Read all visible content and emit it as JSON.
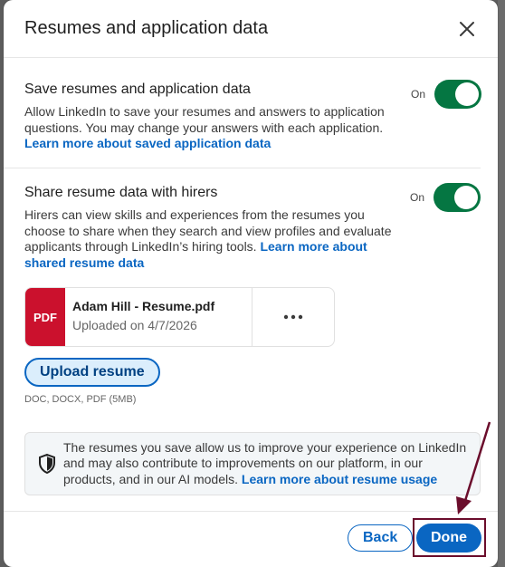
{
  "modal": {
    "title": "Resumes and application data",
    "close_icon": "close-icon"
  },
  "save_section": {
    "title": "Save resumes and application data",
    "description": "Allow LinkedIn to save your resumes and answers to application questions. You may change your answers with each application.",
    "link": "Learn more about saved application data",
    "toggle_label": "On",
    "toggle_on": true
  },
  "share_section": {
    "title": "Share resume data with hirers",
    "description": "Hirers can view skills and experiences from the resumes you choose to share when they search and view profiles and evaluate applicants through LinkedIn’s hiring tools.",
    "link": "Learn more about shared resume data",
    "toggle_label": "On",
    "toggle_on": true
  },
  "resume_file": {
    "type_badge": "PDF",
    "name": "Adam Hill - Resume.pdf",
    "uploaded": "Uploaded on 4/7/2026",
    "more_icon": "ellipsis-icon"
  },
  "upload": {
    "button_label": "Upload resume",
    "file_types": "DOC, DOCX, PDF (5MB)"
  },
  "info": {
    "icon": "shield-icon",
    "text": "The resumes you save allow us to improve your experience on LinkedIn and may also contribute to improvements on our platform, in our products, and in our AI models.",
    "link": "Learn more about resume usage"
  },
  "footer": {
    "back_label": "Back",
    "done_label": "Done"
  },
  "colors": {
    "accent": "#0a66c2",
    "toggle_on": "#057642",
    "pdf_badge": "#cb112d",
    "highlight": "#6b0d2c"
  }
}
